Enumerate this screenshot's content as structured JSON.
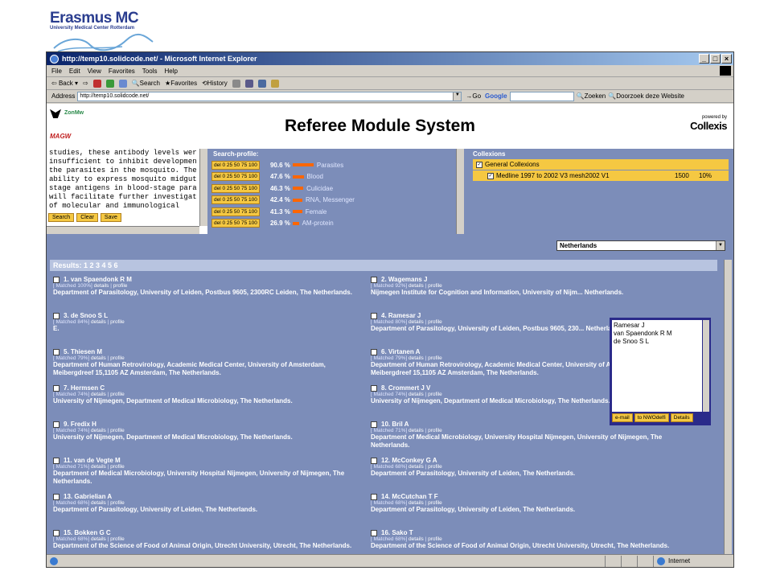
{
  "logo": {
    "brand": "Erasmus MC",
    "sub": "University Medical Center Rotterdam"
  },
  "browser": {
    "title": "http://temp10.solidcode.net/ - Microsoft Internet Explorer",
    "menu": [
      "File",
      "Edit",
      "View",
      "Favorites",
      "Tools",
      "Help"
    ],
    "toolbar": {
      "back": "Back",
      "search": "Search",
      "favorites": "Favorites",
      "history": "History"
    },
    "address_label": "Address",
    "address": "http://temp10.solidcode.net/",
    "go": "Go",
    "google": "Google",
    "zoeken": "Zoeken",
    "doorzoek": "Doorzoek deze Website",
    "status_zone": "Internet"
  },
  "page": {
    "zonmw": "ZonMw",
    "mag": "MAGW",
    "title": "Referee Module System",
    "powered_by": "powered by",
    "collexis": "Collexis",
    "query_text": "studies, these antibody levels wer\ninsufficient to inhibit developmen\nthe parasites in the mosquito. The\nability to express mosquito midgut\nstage antigens in blood-stage para\nwill facilitate further investigat\nof molecular and immunological",
    "query_buttons": {
      "search": "Search",
      "clear": "Clear",
      "save": "Save"
    },
    "profile_title": "Search-profile:",
    "profile_btn": "del 0 25 50 75 100",
    "profile": [
      {
        "pct": "90.6 %",
        "term": "Parasites",
        "value": 90.6
      },
      {
        "pct": "47.6 %",
        "term": "Blood",
        "value": 47.6
      },
      {
        "pct": "46.3 %",
        "term": "Culicidae",
        "value": 46.3
      },
      {
        "pct": "42.4 %",
        "term": "RNA, Messenger",
        "value": 42.4
      },
      {
        "pct": "41.3 %",
        "term": "Female",
        "value": 41.3
      },
      {
        "pct": "26.9 %",
        "term": "AM-protein",
        "value": 26.9
      }
    ],
    "collex_title": "Collexions",
    "collex_general": "General Collexions",
    "collex_item": {
      "name": "Medline 1997 to 2002 V3 mesh2002 V1",
      "count": "1500",
      "pct": "10%"
    },
    "country": "Netherlands",
    "results_label": "Results: 1 2 3 4 5 6",
    "select_list": [
      "Ramesar J",
      "van Spaendonk R M",
      "de Snoo S L"
    ],
    "select_buttons": {
      "email": "e-mail",
      "nwo": "to NWOdelfi",
      "details": "Details"
    },
    "details_link": "details",
    "profile_link": "profile"
  },
  "results": [
    {
      "name": "1. van Spaendonk R M",
      "matched": "[ Matched 100%]",
      "checked": true,
      "aff": "Department of Parasitology, University of Leiden, Postbus 9605, 2300RC Leiden, The Netherlands."
    },
    {
      "name": "2. Wagemans J",
      "matched": "[ Matched 92%]",
      "checked": false,
      "aff": "Nijmegen Institute for Cognition and Information, University of Nijm... Netherlands."
    },
    {
      "name": "3. de Snoo S L",
      "matched": "[ Matched 84%]",
      "checked": true,
      "aff": "E."
    },
    {
      "name": "4. Ramesar J",
      "matched": "[ Matched 80%]",
      "checked": true,
      "aff": "Department of Parasitology, University of Leiden, Postbus 9605, 230... Netherlands."
    },
    {
      "name": "5. Thiesen M",
      "matched": "[ Matched 79%]",
      "checked": false,
      "aff": "Department of Human Retrovirology, Academic Medical Center, University of Amsterdam, Meibergdreef 15,1105 AZ Amsterdam, The Netherlands."
    },
    {
      "name": "6. Virtanen A",
      "matched": "[ Matched 79%]",
      "checked": false,
      "aff": "Department of Human Retrovirology, Academic Medical Center, University of Amsterdam, Meibergdreef 15,1105 AZ Amsterdam, The Netherlands."
    },
    {
      "name": "7. Hermsen C",
      "matched": "[ Matched 74%]",
      "checked": false,
      "aff": "University of Nijmegen, Department of Medical Microbiology, The Netherlands."
    },
    {
      "name": "8. Crommert J V",
      "matched": "[ Matched 74%]",
      "checked": false,
      "aff": "University of Nijmegen, Department of Medical Microbiology, The Netherlands."
    },
    {
      "name": "9. Fredix H",
      "matched": "[ Matched 74%]",
      "checked": false,
      "aff": "University of Nijmegen, Department of Medical Microbiology, The Netherlands."
    },
    {
      "name": "10. Bril A",
      "matched": "[ Matched 71%]",
      "checked": false,
      "aff": "Department of Medical Microbiology, University Hospital Nijmegen, University of Nijmegen, The Netherlands."
    },
    {
      "name": "11. van de Vegte M",
      "matched": "[ Matched 71%]",
      "checked": false,
      "aff": "Department of Medical Microbiology, University Hospital Nijmegen, University of Nijmegen, The Netherlands."
    },
    {
      "name": "12. McConkey G A",
      "matched": "[ Matched 68%]",
      "checked": false,
      "aff": "Department of Parasitology, University of Leiden, The Netherlands."
    },
    {
      "name": "13. Gabrielian A",
      "matched": "[ Matched 68%]",
      "checked": false,
      "aff": "Department of Parasitology, University of Leiden, The Netherlands."
    },
    {
      "name": "14. McCutchan T F",
      "matched": "[ Matched 68%]",
      "checked": false,
      "aff": "Department of Parasitology, University of Leiden, The Netherlands."
    },
    {
      "name": "15. Bokken G C",
      "matched": "[ Matched 68%]",
      "checked": false,
      "aff": "Department of the Science of Food of Animal Origin, Utrecht University, Utrecht, The Netherlands."
    },
    {
      "name": "16. Sako T",
      "matched": "[ Matched 68%]",
      "checked": false,
      "aff": "Department of the Science of Food of Animal Origin, Utrecht University, Utrecht, The Netherlands."
    }
  ]
}
